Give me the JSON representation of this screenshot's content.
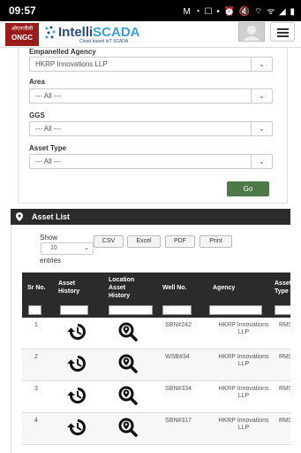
{
  "status_bar": {
    "time": "09:57",
    "icons": "M ◔ ☐ • ⏰ 🔇 ⌔ ᯤ ◢ ▮"
  },
  "header": {
    "logo_top": "ओएनजीसी",
    "logo_name": "ONGC",
    "brand_prefix": "Intelli",
    "brand_suffix": "SCADA",
    "brand_tagline": "Cloud based IoT SCADA",
    "menu_icon": "hamburger-icon",
    "avatar_icon": "user-avatar-icon"
  },
  "filters": {
    "agency_label": "Empanelled Agency",
    "agency_value": "HKRP Innovations LLP",
    "area_label": "Area",
    "area_value": "--- All ---",
    "ggs_label": "GGS",
    "ggs_value": "--- All ---",
    "asset_type_label": "Asset Type",
    "asset_type_value": "--- All ---",
    "go_label": "Go"
  },
  "asset_list": {
    "title": "Asset List",
    "show_label": "Show",
    "entries_label": "entries",
    "page_length": "10",
    "export_buttons": [
      "CSV",
      "Excel",
      "PDF",
      "Print"
    ],
    "columns": [
      "Sr No.",
      "Asset History",
      "Location Asset History",
      "Well No.",
      "Agency",
      "Asset Type"
    ],
    "rows": [
      {
        "sr": "1",
        "well": "SBN#242",
        "agency": "HKRP Innovations LLP",
        "type": "RMS"
      },
      {
        "sr": "2",
        "well": "WSB#34",
        "agency": "HKRP Innovations LLP",
        "type": "RMS"
      },
      {
        "sr": "3",
        "well": "SBN#334",
        "agency": "HKRP Innovations LLP",
        "type": "RMS"
      },
      {
        "sr": "4",
        "well": "SBN#317",
        "agency": "HKRP Innovations LLP",
        "type": "RMS"
      }
    ]
  },
  "colors": {
    "header_dark": "#2b2b2b",
    "go_button": "#4e7a4a",
    "brand_blue": "#2a4b8c"
  }
}
